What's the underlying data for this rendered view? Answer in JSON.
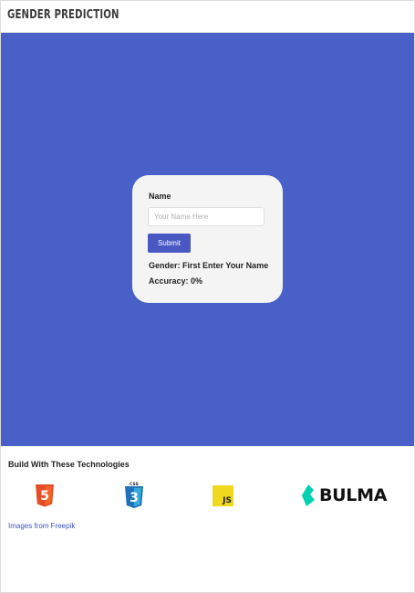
{
  "app": {
    "title": "GENDER PREDICTION"
  },
  "form": {
    "name_label": "Name",
    "name_placeholder": "Your Name Here",
    "submit_label": "Submit",
    "gender_text": "Gender: First Enter Your Name",
    "accuracy_text": "Accuracy: 0%"
  },
  "footer": {
    "title": "Build With These Technologies",
    "technologies": [
      {
        "name": "HTML5",
        "icon": "html5-icon",
        "badge": "5",
        "color": "#e44d26"
      },
      {
        "name": "CSS3",
        "icon": "css3-icon",
        "badge": "3",
        "caption": "CSS",
        "color": "#1f72b8"
      },
      {
        "name": "JS",
        "icon": "javascript-icon",
        "badge": "JS",
        "color": "#f0d81e"
      },
      {
        "name": "BULMA",
        "icon": "bulma-icon",
        "color": "#00d1b2"
      }
    ],
    "credit_link": "Images from Freepik"
  },
  "colors": {
    "hero": "#4860c8",
    "button": "#4a58c4",
    "card": "#f4f4f4",
    "link": "#3b55c2"
  }
}
